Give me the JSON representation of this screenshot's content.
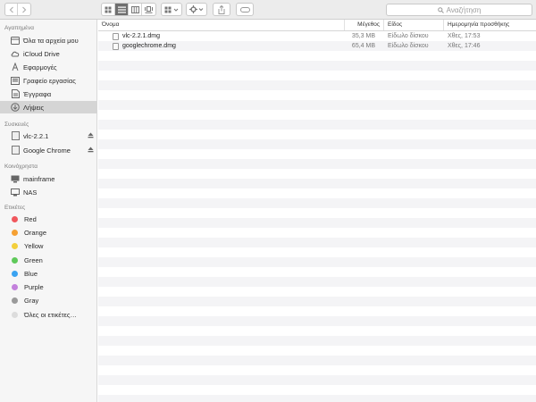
{
  "toolbar": {
    "search_placeholder": "Αναζήτηση"
  },
  "sidebar": {
    "favorites_heading": "Αγαπημένα",
    "favorites": [
      {
        "label": "Όλα τα αρχεία μου"
      },
      {
        "label": "iCloud Drive"
      },
      {
        "label": "Εφαρμογές"
      },
      {
        "label": "Γραφείο εργασίας"
      },
      {
        "label": "Έγγραφα"
      },
      {
        "label": "Λήψεις",
        "selected": true
      }
    ],
    "devices_heading": "Συσκευές",
    "devices": [
      {
        "label": "vlc-2.2.1"
      },
      {
        "label": "Google Chrome"
      }
    ],
    "shared_heading": "Κοινόχρηστα",
    "shared": [
      {
        "label": "mainframe"
      },
      {
        "label": "NAS"
      }
    ],
    "tags_heading": "Ετικέτες",
    "tags": [
      {
        "label": "Red",
        "color": "#f0575d"
      },
      {
        "label": "Orange",
        "color": "#f5a033"
      },
      {
        "label": "Yellow",
        "color": "#f3cf3c"
      },
      {
        "label": "Green",
        "color": "#5fc95a"
      },
      {
        "label": "Blue",
        "color": "#3aa3f1"
      },
      {
        "label": "Purple",
        "color": "#c381dc"
      },
      {
        "label": "Gray",
        "color": "#9a9a9a"
      },
      {
        "label": "Όλες οι ετικέτες…",
        "color": "#dcdcdc"
      }
    ]
  },
  "table": {
    "columns": {
      "name": "Όνομα",
      "size": "Μέγεθος",
      "kind": "Είδος",
      "date_added": "Ημερομηνία προσθήκης"
    },
    "rows": [
      {
        "name": "vlc-2.2.1.dmg",
        "size": "35,3 MB",
        "kind": "Είδωλο δίσκου",
        "date_added": "Χθες, 17:53"
      },
      {
        "name": "googlechrome.dmg",
        "size": "65,4 MB",
        "kind": "Είδωλο δίσκου",
        "date_added": "Χθες, 17:46"
      }
    ]
  }
}
